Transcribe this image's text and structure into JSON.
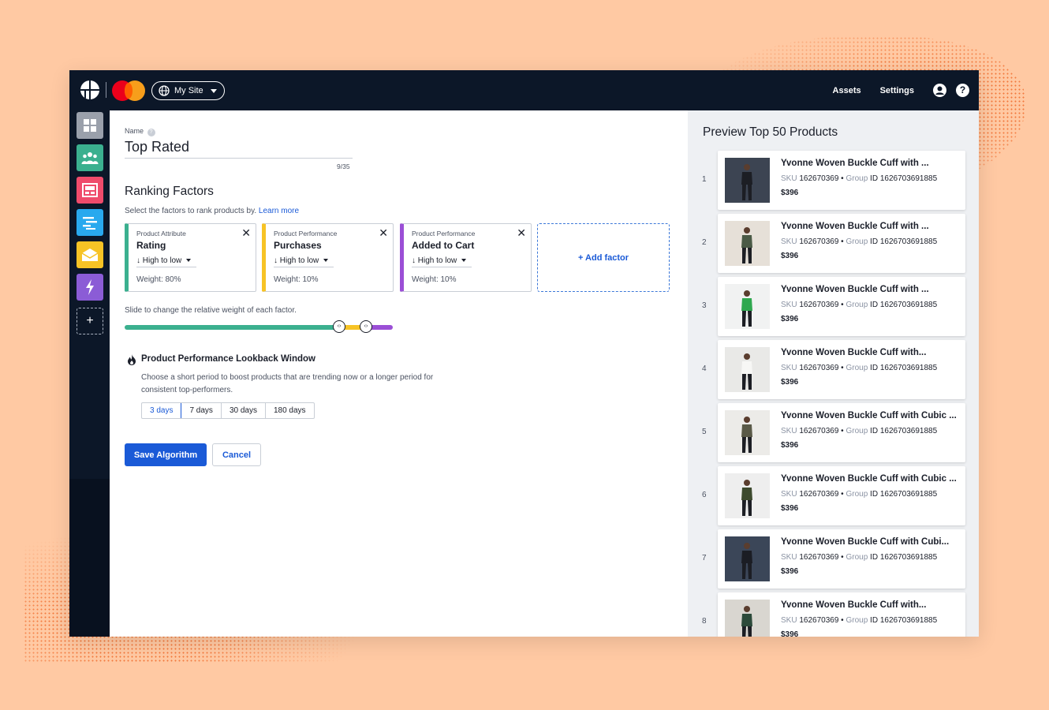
{
  "header": {
    "site_label": "My Site",
    "nav": [
      "Assets",
      "Settings"
    ]
  },
  "sidebar": {
    "items": [
      {
        "icon": "grid-icon",
        "color": "#9aa0ab"
      },
      {
        "icon": "people-icon",
        "color": "#3bb08f"
      },
      {
        "icon": "layout-icon",
        "color": "#ef4b6b"
      },
      {
        "icon": "list-icon",
        "color": "#29a9ee"
      },
      {
        "icon": "mail-icon",
        "color": "#f7c325"
      },
      {
        "icon": "bolt-icon",
        "color": "#8b5cd6"
      },
      {
        "icon": "plus-icon",
        "color": "transparent"
      }
    ]
  },
  "form": {
    "name_label": "Name",
    "name_value": "Top Rated",
    "char_count": "9/35",
    "ranking_title": "Ranking Factors",
    "ranking_desc": "Select the factors to rank products by.",
    "learn_more": "Learn more",
    "factors": [
      {
        "type": "Product Attribute",
        "name": "Rating",
        "sort": "↓ High to low",
        "weight": "Weight: 80%",
        "color": "#3bb08f"
      },
      {
        "type": "Product Performance",
        "name": "Purchases",
        "sort": "↓ High to low",
        "weight": "Weight: 10%",
        "color": "#f7c325"
      },
      {
        "type": "Product Performance",
        "name": "Added to Cart",
        "sort": "↓ High to low",
        "weight": "Weight: 10%",
        "color": "#9b4fd6"
      }
    ],
    "add_factor": "+ Add factor",
    "slider_label": "Slide to change the relative weight of each factor.",
    "slider_weights": [
      0.8,
      0.1,
      0.1
    ],
    "lookback_title": "Product Performance Lookback Window",
    "lookback_desc_1": "Choose a short period to boost products that are trending now or a longer period for",
    "lookback_desc_2": "consistent top-performers.",
    "periods": [
      "3 days",
      "7 days",
      "30 days",
      "180 days"
    ],
    "selected_period": "3 days",
    "save_label": "Save Algorithm",
    "cancel_label": "Cancel"
  },
  "preview": {
    "title": "Preview Top 50 Products",
    "sku_label": "SKU",
    "group_label": "Group",
    "id_label": "ID",
    "products": [
      {
        "rank": "1",
        "name": "Yvonne Woven Buckle Cuff with ...",
        "sku": "162670369",
        "group_id": "1626703691885",
        "price": "$396",
        "bg": "#3c4452",
        "figure": "#1c1e24"
      },
      {
        "rank": "2",
        "name": "Yvonne Woven Buckle Cuff with ...",
        "sku": "162670369",
        "group_id": "1626703691885",
        "price": "$396",
        "bg": "#e6e0d8",
        "figure": "#4a5a46"
      },
      {
        "rank": "3",
        "name": "Yvonne Woven Buckle Cuff with ...",
        "sku": "162670369",
        "group_id": "1626703691885",
        "price": "$396",
        "bg": "#f1f2f2",
        "figure": "#2fa84f"
      },
      {
        "rank": "4",
        "name": "Yvonne Woven Buckle Cuff with...",
        "sku": "162670369",
        "group_id": "1626703691885",
        "price": "$396",
        "bg": "#e9e9e7",
        "figure": "#f7f7f5"
      },
      {
        "rank": "5",
        "name": "Yvonne Woven Buckle Cuff with Cubic ...",
        "sku": "162670369",
        "group_id": "1626703691885",
        "price": "$396",
        "bg": "#ecebe8",
        "figure": "#5a5a48"
      },
      {
        "rank": "6",
        "name": "Yvonne Woven Buckle Cuff with Cubic ...",
        "sku": "162670369",
        "group_id": "1626703691885",
        "price": "$396",
        "bg": "#eeeeee",
        "figure": "#3d4a2e"
      },
      {
        "rank": "7",
        "name": "Yvonne Woven Buckle Cuff with Cubi...",
        "sku": "162670369",
        "group_id": "1626703691885",
        "price": "$396",
        "bg": "#3b4658",
        "figure": "#1b1d24"
      },
      {
        "rank": "8",
        "name": "Yvonne Woven Buckle Cuff with...",
        "sku": "162670369",
        "group_id": "1626703691885",
        "price": "$396",
        "bg": "#d9d6d0",
        "figure": "#2c4a3a"
      }
    ]
  }
}
